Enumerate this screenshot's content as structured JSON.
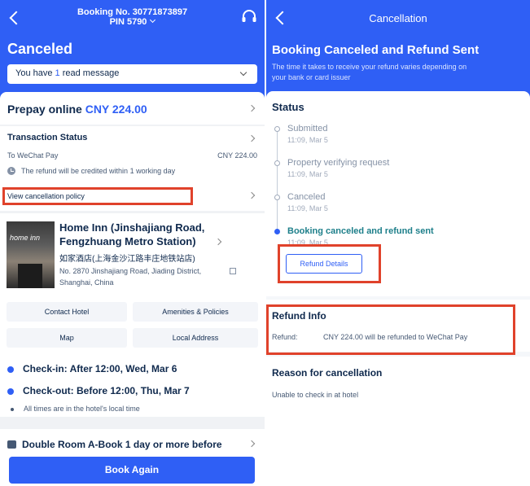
{
  "left": {
    "header": {
      "booking_no": "Booking No. 30771873897",
      "pin": "PIN 5790",
      "status_title": "Canceled"
    },
    "message": {
      "prefix": "You have ",
      "count": "1",
      "suffix": " read message"
    },
    "prepay": {
      "label": "Prepay online",
      "amount": "CNY 224.00"
    },
    "transaction": {
      "title": "Transaction Status",
      "to": "To WeChat Pay",
      "amount": "CNY 224.00",
      "note": "The refund will be credited within 1 working day",
      "policy_link": "View cancellation policy"
    },
    "hotel": {
      "image_text": "home inn",
      "name_line1": "Home Inn (Jinshajiang Road,",
      "name_line2": "Fengzhuang Metro Station)",
      "name_cn": "如家酒店(上海金沙江路丰庄地铁站店)",
      "address_line1": "No. 2870 Jinshajiang Road, Jiading District,",
      "address_line2": "Shanghai, China",
      "buttons": [
        "Contact Hotel",
        "Amenities & Policies",
        "Map",
        "Local Address"
      ],
      "checkin": "Check-in: After 12:00, Wed, Mar 6",
      "checkout": "Check-out: Before 12:00, Thu, Mar 7",
      "local_note": "All times are in the hotel's local time"
    },
    "room": {
      "label": "Double Room A-Book 1 day or more before"
    },
    "footer": {
      "book_again": "Book Again"
    }
  },
  "right": {
    "header": {
      "title": "Cancellation",
      "main": "Booking Canceled and Refund Sent",
      "sub_line1": "The time it takes to receive your refund varies depending on",
      "sub_line2": "your bank or card issuer"
    },
    "status": {
      "title": "Status",
      "steps": [
        {
          "label": "Submitted",
          "time": "11:09, Mar 5"
        },
        {
          "label": "Property verifying request",
          "time": "11:09, Mar 5"
        },
        {
          "label": "Canceled",
          "time": "11:09, Mar 5"
        },
        {
          "label": "Booking canceled and refund sent",
          "time": "11:09, Mar 5"
        }
      ],
      "refund_details": "Refund Details"
    },
    "refund_info": {
      "title": "Refund Info",
      "key": "Refund:",
      "value": "CNY 224.00 will be refunded to WeChat Pay"
    },
    "reason": {
      "title": "Reason for cancellation",
      "text": "Unable to check in at hotel"
    }
  },
  "colors": {
    "brand_blue": "#2f5ff5",
    "highlight_red": "#e0422b",
    "active_teal": "#1d7f8a"
  }
}
